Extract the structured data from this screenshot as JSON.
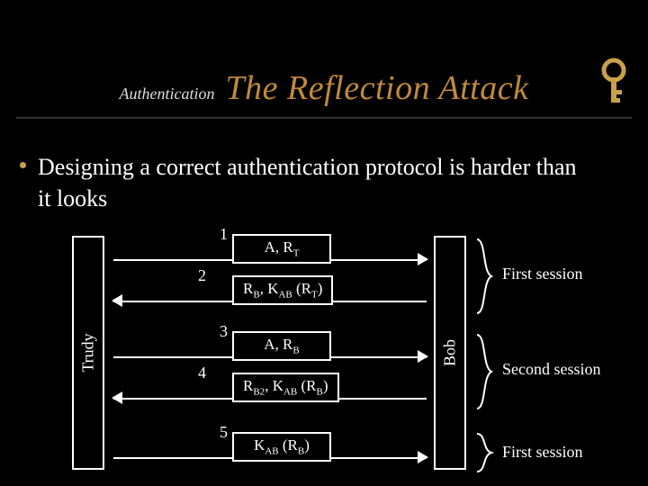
{
  "header": {
    "subtitle": "Authentication",
    "title": "The Reflection Attack",
    "icon": "key-icon"
  },
  "bullet": "Designing a correct authentication protocol is harder than it looks",
  "diagram": {
    "left_party": "Trudy",
    "right_party": "Bob",
    "messages": [
      {
        "num": "1",
        "dir": "right",
        "text_html": "A, R<sub>T</sub>"
      },
      {
        "num": "2",
        "dir": "left",
        "text_html": "R<sub>B</sub>, K<sub>AB</sub> (R<sub>T</sub>)"
      },
      {
        "num": "3",
        "dir": "right",
        "text_html": "A, R<sub>B</sub>"
      },
      {
        "num": "4",
        "dir": "left",
        "text_html": "R<sub>B2</sub>, K<sub>AB</sub> (R<sub>B</sub>)"
      },
      {
        "num": "5",
        "dir": "right",
        "text_html": "K<sub>AB</sub> (R<sub>B</sub>)"
      }
    ],
    "sessions": [
      {
        "label": "First session"
      },
      {
        "label": "Second session"
      },
      {
        "label": "First session"
      }
    ]
  }
}
